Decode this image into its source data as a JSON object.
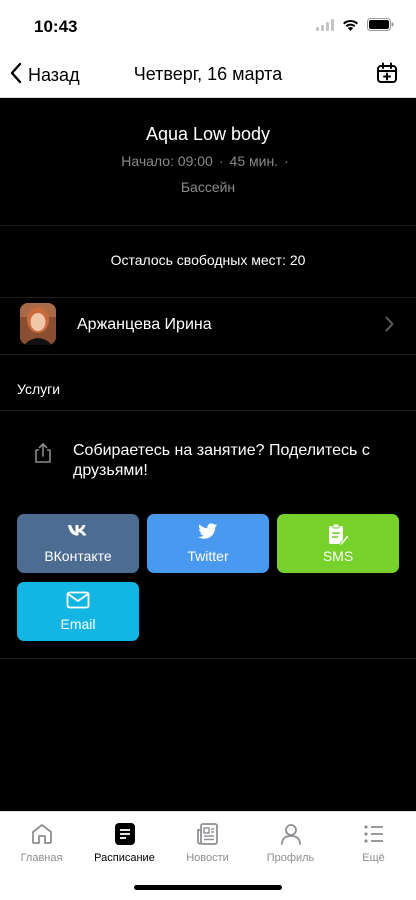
{
  "status": {
    "time": "10:43"
  },
  "nav": {
    "back_label": "Назад",
    "title": "Четверг, 16 марта"
  },
  "session": {
    "title": "Aqua Low body",
    "start": "Начало: 09:00",
    "duration": "45 мин.",
    "sep": "·",
    "place": "Бассейн",
    "seats_left": "Осталось свободных мест: 20"
  },
  "trainer": {
    "name": "Аржанцева Ирина"
  },
  "services_label": "Услуги",
  "share": {
    "text": "Собираетесь на занятие? Поделитесь с друзьями!",
    "buttons": [
      {
        "label": "ВКонтакте",
        "icon": "vk-icon",
        "color": "#4d6c92"
      },
      {
        "label": "Twitter",
        "icon": "twitter-icon",
        "color": "#4a99f0"
      },
      {
        "label": "SMS",
        "icon": "sms-icon",
        "color": "#76d12a"
      },
      {
        "label": "Email",
        "icon": "email-icon",
        "color": "#13b5e3"
      }
    ]
  },
  "tabs": [
    {
      "label": "Главная",
      "icon": "home-icon",
      "active": false
    },
    {
      "label": "Расписание",
      "icon": "schedule-icon",
      "active": true
    },
    {
      "label": "Новости",
      "icon": "news-icon",
      "active": false
    },
    {
      "label": "Профиль",
      "icon": "profile-icon",
      "active": false
    },
    {
      "label": "Ещё",
      "icon": "more-icon",
      "active": false
    }
  ]
}
